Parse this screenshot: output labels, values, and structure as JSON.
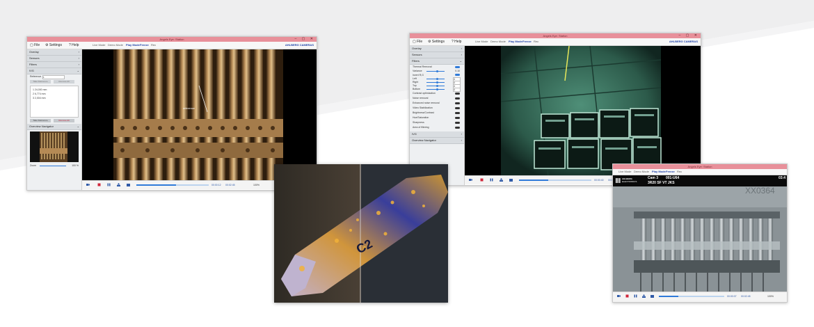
{
  "win1": {
    "title": "Angels Eye: Station",
    "menu": {
      "file": "File",
      "settings": "Settings",
      "help": "Help"
    },
    "modes": [
      "Live Mode",
      "Demo Mode",
      "Play Mode",
      "Freeze",
      "Rec"
    ],
    "brand": "AHLBERG CAMERAS",
    "sections": [
      "Overlay",
      "Sensors",
      "Filters",
      "IVG"
    ],
    "ivg": {
      "reference_label": "Reference",
      "reference_value": "1",
      "measurements": [
        "1  24,000 mm",
        "2  6,774 mm",
        "3  2,004 mm"
      ],
      "button_left": "Take Reference",
      "button_right": "Remove All"
    },
    "navigator": "Overview Navigator",
    "zoom_label": "Zoom",
    "zoom_value": "100 %",
    "reference_tag": "reference",
    "time_current": "00:00:12",
    "time_total": "00:02:45",
    "playback_progress": 0.55,
    "speed": "100%"
  },
  "win2": {
    "title": "Angels Eye: Station",
    "menu": {
      "file": "File",
      "settings": "Settings",
      "help": "Help"
    },
    "modes": [
      "Live Mode",
      "Demo Mode",
      "Play Mode",
      "Freeze",
      "Rec"
    ],
    "brand": "AHLBERG CAMERAS",
    "sections": [
      "Overlay",
      "Sensors",
      "Filters",
      "IVG",
      "Overview Navigator"
    ],
    "filters": [
      {
        "label": "Thermal Removal",
        "on": true
      },
      {
        "label": "Variance",
        "value": "0.10"
      },
      {
        "label": "Invert R,G",
        "on": true
      },
      {
        "label": "Left",
        "value": "4"
      },
      {
        "label": "Right",
        "value": "4"
      },
      {
        "label": "Top",
        "value": "4"
      },
      {
        "label": "Bottom",
        "value": "4"
      },
      {
        "label": "Contrast optimization",
        "on": false
      },
      {
        "label": "Noise removal",
        "on": false
      },
      {
        "label": "Enhanced noise removal",
        "on": false
      },
      {
        "label": "Video Stabilization",
        "on": false
      },
      {
        "label": "Brightness/Contrast",
        "on": false
      },
      {
        "label": "Hue/Saturation",
        "on": false
      },
      {
        "label": "Sharpness",
        "on": false
      },
      {
        "label": "Area of filtering",
        "on": false
      }
    ],
    "time_current": "00:00:40",
    "time_total": "00:02:45",
    "playback_progress": 0.4,
    "speed": "100%"
  },
  "win3": {
    "title": "Angels Eye: Station",
    "modes": [
      "Live Mode",
      "Demo Mode",
      "Play Mode",
      "Freeze",
      "Rec"
    ],
    "brand_line1": "AHLBERG",
    "brand_line2": "ELECTRONICS",
    "cam": "Cam 3",
    "cam_id": "001-U64",
    "code": "3R20 SF VT JKS",
    "corner": "03:4",
    "plate_text": "XX0364",
    "time_current": "00:00:07",
    "time_total": "00:02:45",
    "playback_progress": 0.3,
    "speed": "100%"
  },
  "photo": {
    "label": "C2"
  }
}
